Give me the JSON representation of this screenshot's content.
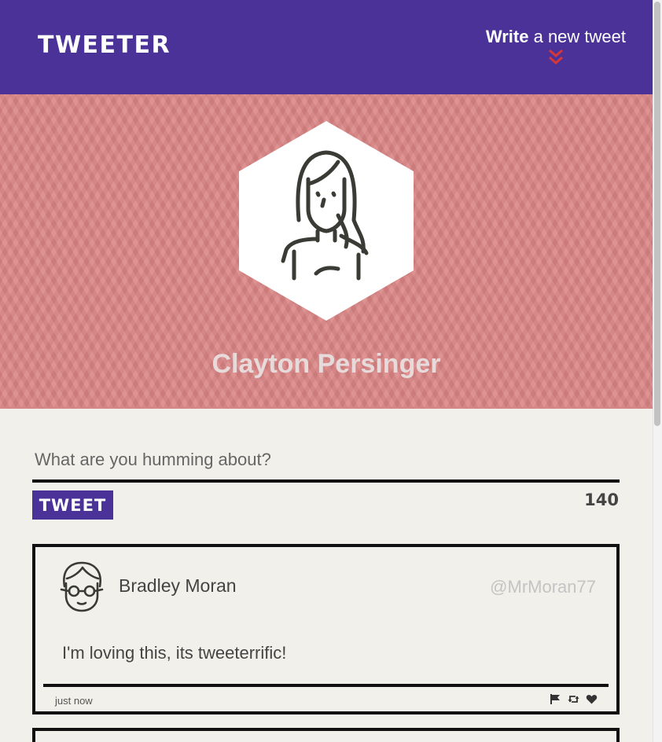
{
  "nav": {
    "brand": "TWEETER",
    "compose_strong": "Write",
    "compose_rest": " a new tweet",
    "chevron_color": "#d63737"
  },
  "profile": {
    "name": "Clayton Persinger"
  },
  "compose": {
    "placeholder": "What are you humming about?",
    "button_label": "TWEET",
    "counter": "140"
  },
  "tweets": [
    {
      "name": "Bradley Moran",
      "handle": "@MrMoran77",
      "content": "I'm loving this, its tweeterrific!",
      "time": "just now",
      "actions": [
        "flag-icon",
        "retweet-icon",
        "heart-icon"
      ]
    }
  ],
  "colors": {
    "nav_bg": "#4a3298",
    "header_bg": "#d98383",
    "page_bg": "#f1f0ea",
    "line": "#111111",
    "icon_dark": "#3b3b35"
  }
}
